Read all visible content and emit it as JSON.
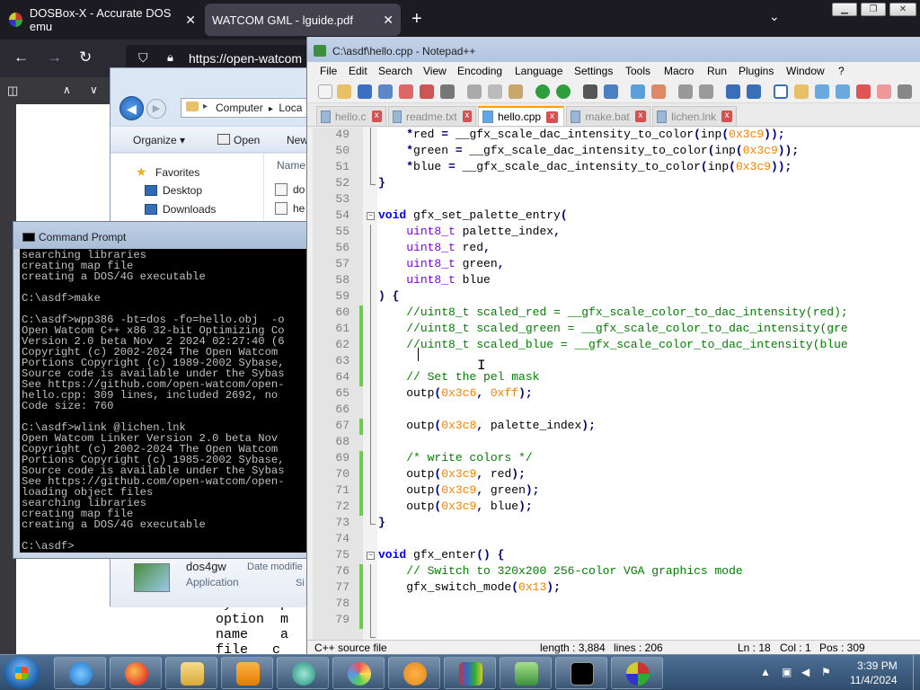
{
  "browser": {
    "tabs": [
      {
        "label": "DOSBox-X - Accurate DOS emu",
        "close": "✕"
      },
      {
        "label": "WATCOM GML - lguide.pdf",
        "close": "✕"
      }
    ],
    "new_tab": "+",
    "tab_list": "⌄",
    "window_controls": {
      "minimize": "▁",
      "maximize": "❐",
      "close": "✕"
    },
    "nav": {
      "back": "←",
      "forward": "→",
      "reload": "↻"
    },
    "url": "https://open-watcom",
    "pdf_toolbar": {
      "sidebar": "◫",
      "prev": "∧",
      "next": "∨"
    },
    "page_text": [
      "system  p",
      "option  m",
      "name    a",
      "file   c"
    ]
  },
  "explorer": {
    "back": "◀",
    "forward": "▶",
    "address": [
      "Computer",
      "Loca"
    ],
    "address_sep": "▸",
    "commands": {
      "organize": "Organize ▾",
      "open": "Open",
      "new": "New"
    },
    "nav_items": [
      {
        "label": "Favorites"
      },
      {
        "label": "Desktop"
      },
      {
        "label": "Downloads"
      }
    ],
    "column_name": "Name",
    "files": [
      "do",
      "he"
    ],
    "details": {
      "name": "dos4gw",
      "type": "Application",
      "modified": "Date modifie",
      "size": "Si"
    }
  },
  "cmd": {
    "title": "Command Prompt",
    "lines": [
      "searching libraries",
      "creating map file",
      "creating a DOS/4G executable",
      "",
      "C:\\asdf>make",
      "",
      "C:\\asdf>wpp386 -bt=dos -fo=hello.obj  -o",
      "Open Watcom C++ x86 32-bit Optimizing Co",
      "Version 2.0 beta Nov  2 2024 02:27:40 (6",
      "Copyright (c) 2002-2024 The Open Watcom",
      "Portions Copyright (c) 1989-2002 Sybase,",
      "Source code is available under the Sybas",
      "See https://github.com/open-watcom/open-",
      "hello.cpp: 309 lines, included 2692, no",
      "Code size: 760",
      "",
      "C:\\asdf>wlink @lichen.lnk",
      "Open Watcom Linker Version 2.0 beta Nov",
      "Copyright (c) 2002-2024 The Open Watcom",
      "Portions Copyright (c) 1985-2002 Sybase,",
      "Source code is available under the Sybas",
      "See https://github.com/open-watcom/open-",
      "loading object files",
      "searching libraries",
      "creating map file",
      "creating a DOS/4G executable",
      "",
      "C:\\asdf>"
    ]
  },
  "npp": {
    "title": "C:\\asdf\\hello.cpp - Notepad++",
    "menu": [
      "File",
      "Edit",
      "Search",
      "View",
      "Encoding",
      "Language",
      "Settings",
      "Tools",
      "Macro",
      "Run",
      "Plugins",
      "Window",
      "?"
    ],
    "tabs": [
      {
        "label": "hello.c",
        "active": false
      },
      {
        "label": "readme.txt",
        "active": false
      },
      {
        "label": "hello.cpp",
        "active": true
      },
      {
        "label": "make.bat",
        "active": false
      },
      {
        "label": "lichen.lnk",
        "active": false
      }
    ],
    "tab_close": "x",
    "fold_open": "−",
    "line_numbers": [
      "49",
      "50",
      "51",
      "52",
      "53",
      "54",
      "55",
      "56",
      "57",
      "58",
      "59",
      "60",
      "61",
      "62",
      "63",
      "64",
      "65",
      "66",
      "67",
      "68",
      "69",
      "70",
      "71",
      "72",
      "73",
      "74",
      "75",
      "76",
      "77",
      "78",
      "79"
    ],
    "code": [
      [
        {
          "t": "    "
        },
        {
          "t": "*",
          "c": "op"
        },
        {
          "t": "red "
        },
        {
          "t": "=",
          "c": "op"
        },
        {
          "t": " __gfx_scale_dac_intensity_to_color"
        },
        {
          "t": "(",
          "c": "op"
        },
        {
          "t": "inp"
        },
        {
          "t": "(",
          "c": "op"
        },
        {
          "t": "0x3c9",
          "c": "hx"
        },
        {
          "t": "));",
          "c": "op"
        }
      ],
      [
        {
          "t": "    "
        },
        {
          "t": "*",
          "c": "op"
        },
        {
          "t": "green "
        },
        {
          "t": "=",
          "c": "op"
        },
        {
          "t": " __gfx_scale_dac_intensity_to_color"
        },
        {
          "t": "(",
          "c": "op"
        },
        {
          "t": "inp"
        },
        {
          "t": "(",
          "c": "op"
        },
        {
          "t": "0x3c9",
          "c": "hx"
        },
        {
          "t": "));",
          "c": "op"
        }
      ],
      [
        {
          "t": "    "
        },
        {
          "t": "*",
          "c": "op"
        },
        {
          "t": "blue "
        },
        {
          "t": "=",
          "c": "op"
        },
        {
          "t": " __gfx_scale_dac_intensity_to_color"
        },
        {
          "t": "(",
          "c": "op"
        },
        {
          "t": "inp"
        },
        {
          "t": "(",
          "c": "op"
        },
        {
          "t": "0x3c9",
          "c": "hx"
        },
        {
          "t": "));",
          "c": "op"
        }
      ],
      [
        {
          "t": "}",
          "c": "op"
        }
      ],
      [],
      [
        {
          "t": "void",
          "c": "kw"
        },
        {
          "t": " gfx_set_palette_entry"
        },
        {
          "t": "(",
          "c": "op"
        }
      ],
      [
        {
          "t": "    "
        },
        {
          "t": "uint8_t",
          "c": "ty"
        },
        {
          "t": " palette_index"
        },
        {
          "t": ",",
          "c": "op"
        }
      ],
      [
        {
          "t": "    "
        },
        {
          "t": "uint8_t",
          "c": "ty"
        },
        {
          "t": " red"
        },
        {
          "t": ",",
          "c": "op"
        }
      ],
      [
        {
          "t": "    "
        },
        {
          "t": "uint8_t",
          "c": "ty"
        },
        {
          "t": " green"
        },
        {
          "t": ",",
          "c": "op"
        }
      ],
      [
        {
          "t": "    "
        },
        {
          "t": "uint8_t",
          "c": "ty"
        },
        {
          "t": " blue"
        }
      ],
      [
        {
          "t": ") {",
          "c": "op"
        }
      ],
      [
        {
          "t": "    "
        },
        {
          "t": "//uint8_t scaled_red = __gfx_scale_color_to_dac_intensity(red);",
          "c": "cm"
        }
      ],
      [
        {
          "t": "    "
        },
        {
          "t": "//uint8_t scaled_green = __gfx_scale_color_to_dac_intensity(gre",
          "c": "cm"
        }
      ],
      [
        {
          "t": "    "
        },
        {
          "t": "//uint8_t scaled_blue = __gfx_scale_color_to_dac_intensity(blue",
          "c": "cm"
        }
      ],
      [],
      [
        {
          "t": "    "
        },
        {
          "t": "// Set the pel mask",
          "c": "cm"
        }
      ],
      [
        {
          "t": "    outp"
        },
        {
          "t": "(",
          "c": "op"
        },
        {
          "t": "0x3c6",
          "c": "hx"
        },
        {
          "t": ", ",
          "c": "op"
        },
        {
          "t": "0xff",
          "c": "hx"
        },
        {
          "t": ");",
          "c": "op"
        }
      ],
      [],
      [
        {
          "t": "    outp"
        },
        {
          "t": "(",
          "c": "op"
        },
        {
          "t": "0x3c8",
          "c": "hx"
        },
        {
          "t": ",",
          "c": "op"
        },
        {
          "t": " palette_index"
        },
        {
          "t": ");",
          "c": "op"
        }
      ],
      [],
      [
        {
          "t": "    "
        },
        {
          "t": "/* write colors */",
          "c": "cm"
        }
      ],
      [
        {
          "t": "    outp"
        },
        {
          "t": "(",
          "c": "op"
        },
        {
          "t": "0x3c9",
          "c": "hx"
        },
        {
          "t": ",",
          "c": "op"
        },
        {
          "t": " red"
        },
        {
          "t": ");",
          "c": "op"
        }
      ],
      [
        {
          "t": "    outp"
        },
        {
          "t": "(",
          "c": "op"
        },
        {
          "t": "0x3c9",
          "c": "hx"
        },
        {
          "t": ",",
          "c": "op"
        },
        {
          "t": " green"
        },
        {
          "t": ");",
          "c": "op"
        }
      ],
      [
        {
          "t": "    outp"
        },
        {
          "t": "(",
          "c": "op"
        },
        {
          "t": "0x3c9",
          "c": "hx"
        },
        {
          "t": ",",
          "c": "op"
        },
        {
          "t": " blue"
        },
        {
          "t": ");",
          "c": "op"
        }
      ],
      [
        {
          "t": "}",
          "c": "op"
        }
      ],
      [],
      [
        {
          "t": "void",
          "c": "kw"
        },
        {
          "t": " gfx_enter"
        },
        {
          "t": "() {",
          "c": "op"
        }
      ],
      [
        {
          "t": "    "
        },
        {
          "t": "// Switch to 320x200 256-color VGA graphics mode",
          "c": "cm"
        }
      ],
      [
        {
          "t": "    gfx_switch_mode"
        },
        {
          "t": "(",
          "c": "op"
        },
        {
          "t": "0x13",
          "c": "hx"
        },
        {
          "t": ");",
          "c": "op"
        }
      ],
      [],
      []
    ],
    "status": {
      "type": "C++ source file",
      "length": "length : 3,884",
      "lines": "lines : 206",
      "ln": "Ln : 18",
      "col": "Col : 1",
      "pos": "Pos : 309"
    }
  },
  "taskbar": {
    "clock_time": "3:39 PM",
    "clock_date": "11/4/2024",
    "tray_icons": {
      "chevron": "▲",
      "network": "▣",
      "volume": "◀",
      "flag": "⚑"
    }
  }
}
